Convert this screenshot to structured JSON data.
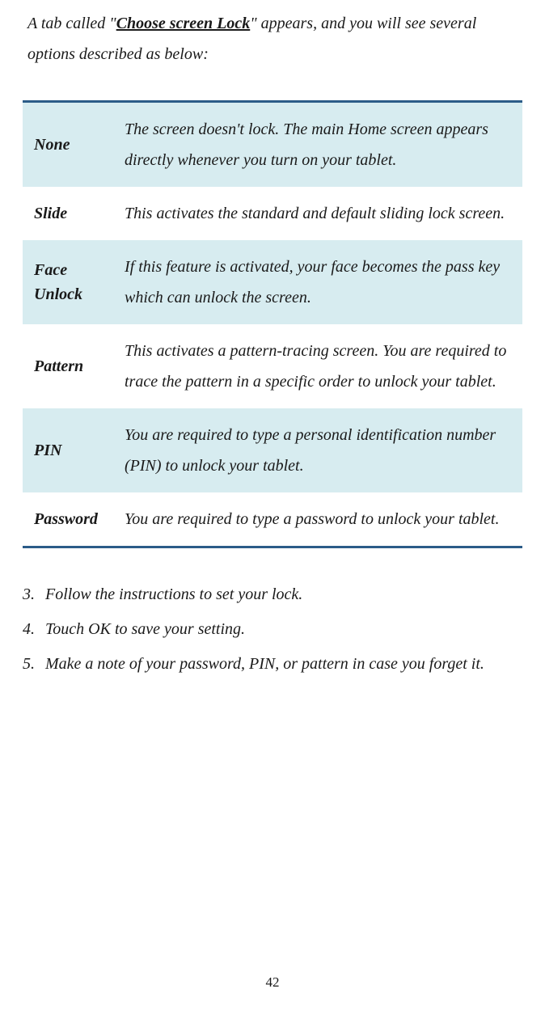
{
  "intro": {
    "before": "A tab called \"",
    "bold": "Choose screen Lock",
    "after": "\" appears, and you will see several options described as below:"
  },
  "rows": [
    {
      "label": "None",
      "desc": "The screen doesn't lock. The main Home screen appears directly whenever you turn on your tablet."
    },
    {
      "label": "Slide",
      "desc": "This activates the standard and default sliding lock screen."
    },
    {
      "label": "Face Unlock",
      "desc": "If this feature is activated, your face becomes the pass key which can unlock the screen."
    },
    {
      "label": "Pattern",
      "desc": "This activates a pattern-tracing screen. You are required to trace the pattern in a specific order to unlock your tablet."
    },
    {
      "label": "PIN",
      "desc": "You are required to type a personal identification number (PIN) to unlock your tablet."
    },
    {
      "label": "Password",
      "desc": "You are required to type a password to unlock your tablet."
    }
  ],
  "steps": [
    {
      "num": "3.",
      "text": "Follow the instructions to set your lock."
    },
    {
      "num": "4.",
      "text": "Touch OK to save your setting."
    },
    {
      "num": "5.",
      "text": "Make a note of your password, PIN, or pattern in case you forget it."
    }
  ],
  "pageNumber": "42"
}
